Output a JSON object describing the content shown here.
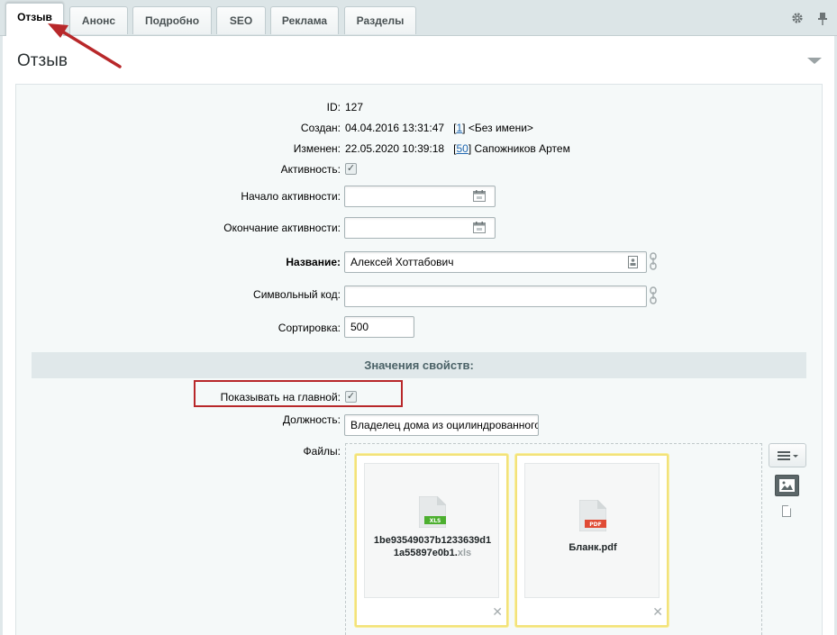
{
  "tabs": [
    {
      "id": "review",
      "label": "Отзыв",
      "active": true
    },
    {
      "id": "announce",
      "label": "Анонс",
      "active": false
    },
    {
      "id": "details",
      "label": "Подробно",
      "active": false
    },
    {
      "id": "seo",
      "label": "SEO",
      "active": false
    },
    {
      "id": "ads",
      "label": "Реклама",
      "active": false
    },
    {
      "id": "sections",
      "label": "Разделы",
      "active": false
    }
  ],
  "toolbar_icons": {
    "settings": "gear-icon",
    "pin": "pin-icon"
  },
  "panel": {
    "title": "Отзыв"
  },
  "fields": {
    "id_label": "ID:",
    "id_value": "127",
    "created_label": "Создан:",
    "created_date": "04.04.2016 13:31:47",
    "created_user_id": "1",
    "created_user_name": "<Без имени>",
    "modified_label": "Изменен:",
    "modified_date": "22.05.2020 10:39:18",
    "modified_user_id": "50",
    "modified_user_name": "Сапожников Артем",
    "active_label": "Активность:",
    "active_checked": true,
    "active_from_label": "Начало активности:",
    "active_from_value": "",
    "active_to_label": "Окончание активности:",
    "active_to_value": "",
    "name_label": "Название:",
    "name_value": "Алексей Хоттабович",
    "code_label": "Символьный код:",
    "code_value": "",
    "sort_label": "Сортировка:",
    "sort_value": "500"
  },
  "properties": {
    "section_title": "Значения свойств:",
    "show_main_label": "Показывать на главной:",
    "show_main_checked": true,
    "position_label": "Должность:",
    "position_value": "Владелец дома из оцилиндрованного",
    "files_label": "Файлы:",
    "files": [
      {
        "name_line1": "1be93549037b1233639d1",
        "name_line2": "1a55897e0b1.",
        "ext": "xls",
        "badge": "XLS",
        "badge_color": "#4caf2f"
      },
      {
        "name_line1": "Бланк.pdf",
        "name_line2": "",
        "ext": "",
        "badge": "PDF",
        "badge_color": "#e04b35"
      }
    ]
  },
  "colors": {
    "highlight": "#b8282a",
    "arrow": "#b8282a",
    "link": "#2067b0"
  }
}
